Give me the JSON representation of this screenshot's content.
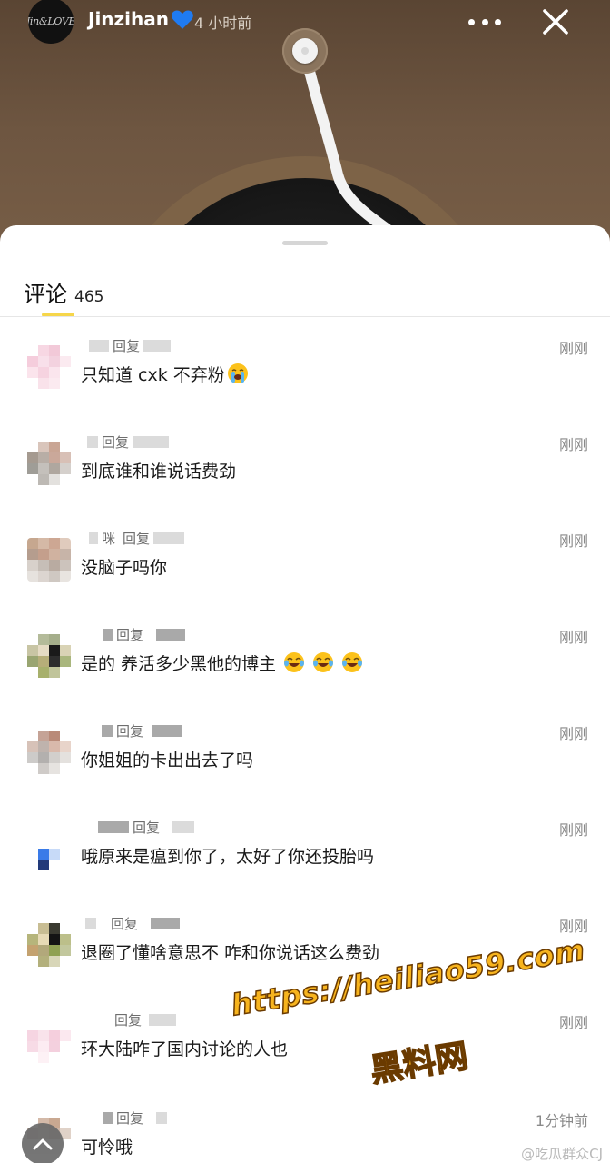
{
  "post": {
    "avatar_text": "Jin&LOVE",
    "username": "Jinzihan",
    "time": "4 小时前"
  },
  "comments_header": {
    "title": "评论",
    "count": "465"
  },
  "comments": [
    {
      "handle_fragment": "",
      "reply_word": "回复",
      "text": "只知道 cxk 不弃粉",
      "time": "刚刚",
      "emoji": "loudly-crying-face"
    },
    {
      "handle_fragment": "",
      "reply_word": "回复",
      "text": "到底谁和谁说话费劲",
      "time": "刚刚"
    },
    {
      "handle_fragment": "咪",
      "reply_word": "回复",
      "text": "没脑子吗你",
      "time": "刚刚"
    },
    {
      "handle_fragment": "",
      "reply_word": "回复",
      "text": "是的  养活多少黑他的博主",
      "time": "刚刚",
      "emoji": "tears-of-joy x3"
    },
    {
      "handle_fragment": "",
      "reply_word": "回复",
      "text": "你姐姐的卡出出去了吗",
      "time": "刚刚"
    },
    {
      "handle_fragment": "",
      "reply_word": "回复",
      "text": "哦原来是瘟到你了，太好了你还投胎吗",
      "time": "刚刚"
    },
    {
      "handle_fragment": "",
      "reply_word": "回复",
      "text": "退圈了懂啥意思不  咋和你说话这么费劲",
      "time": "刚刚"
    },
    {
      "handle_fragment": "",
      "reply_word": "回复",
      "text": "环大陆咋了国内讨论的人也",
      "time": "刚刚"
    },
    {
      "handle_fragment": "",
      "reply_word": "回复",
      "text": "可怜哦",
      "time": "1分钟前"
    }
  ],
  "watermark": {
    "url": "https://heiliao59.com",
    "label": "黑料网",
    "weibo": "@吃瓜群众CJ"
  },
  "colors": {
    "accent_yellow": "#f6d64a",
    "heart_blue": "#1f7bf2",
    "watermark_orange": "#f7b41e"
  },
  "icons": [
    "more-icon",
    "close-icon",
    "blue-heart-icon",
    "chevron-up-icon"
  ]
}
